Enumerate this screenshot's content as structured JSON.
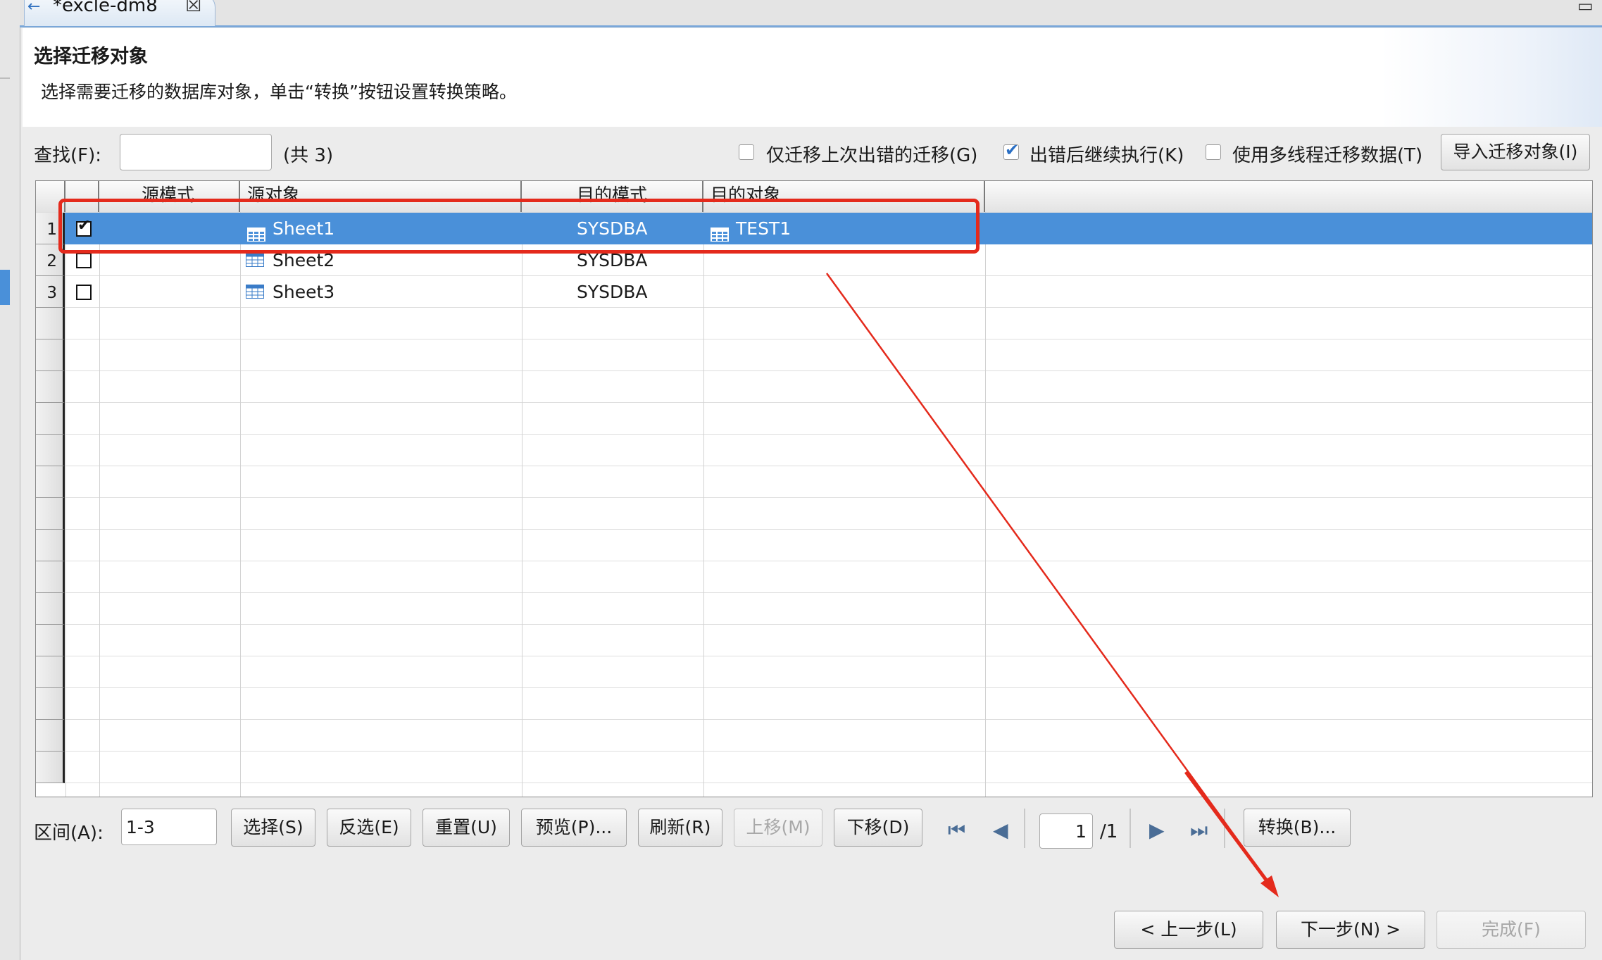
{
  "tab": {
    "title": "*excle-dm8",
    "close": "☒"
  },
  "header": {
    "title": "选择迁移对象",
    "description": "选择需要迁移的数据库对象，单击“转换”按钮设置转换策略。"
  },
  "search": {
    "label": "查找(F):",
    "value": "",
    "count": "(共 3)"
  },
  "options": [
    {
      "label": "仅迁移上次出错的迁移(G)",
      "checked": false
    },
    {
      "label": "出错后继续执行(K)",
      "checked": true
    },
    {
      "label": "使用多线程迁移数据(T)",
      "checked": false
    }
  ],
  "import_button": "导入迁移对象(I)",
  "table": {
    "columns": [
      "源模式",
      "源对象",
      "目的模式",
      "目的对象"
    ],
    "rows": [
      {
        "num": "1",
        "checked": true,
        "src_schema": "",
        "src_object": "Sheet1",
        "dst_schema": "SYSDBA",
        "dst_object": "TEST1",
        "selected": true
      },
      {
        "num": "2",
        "checked": false,
        "src_schema": "",
        "src_object": "Sheet2",
        "dst_schema": "SYSDBA",
        "dst_object": ""
      },
      {
        "num": "3",
        "checked": false,
        "src_schema": "",
        "src_object": "Sheet3",
        "dst_schema": "SYSDBA",
        "dst_object": ""
      }
    ]
  },
  "range": {
    "label": "区间(A):",
    "value": "1-3"
  },
  "toolbar": {
    "select": "选择(S)",
    "invert": "反选(E)",
    "reset": "重置(U)",
    "preview": "预览(P)...",
    "refresh": "刷新(R)",
    "move_up": "上移(M)",
    "move_down": "下移(D)",
    "convert": "转换(B)..."
  },
  "pagination": {
    "current": "1",
    "total": "/1"
  },
  "wizard": {
    "back": "< 上一步(L)",
    "next": "下一步(N) >",
    "finish": "完成(F)"
  },
  "colors": {
    "accent": "#4a90d9",
    "annotation": "#e42a1c"
  }
}
